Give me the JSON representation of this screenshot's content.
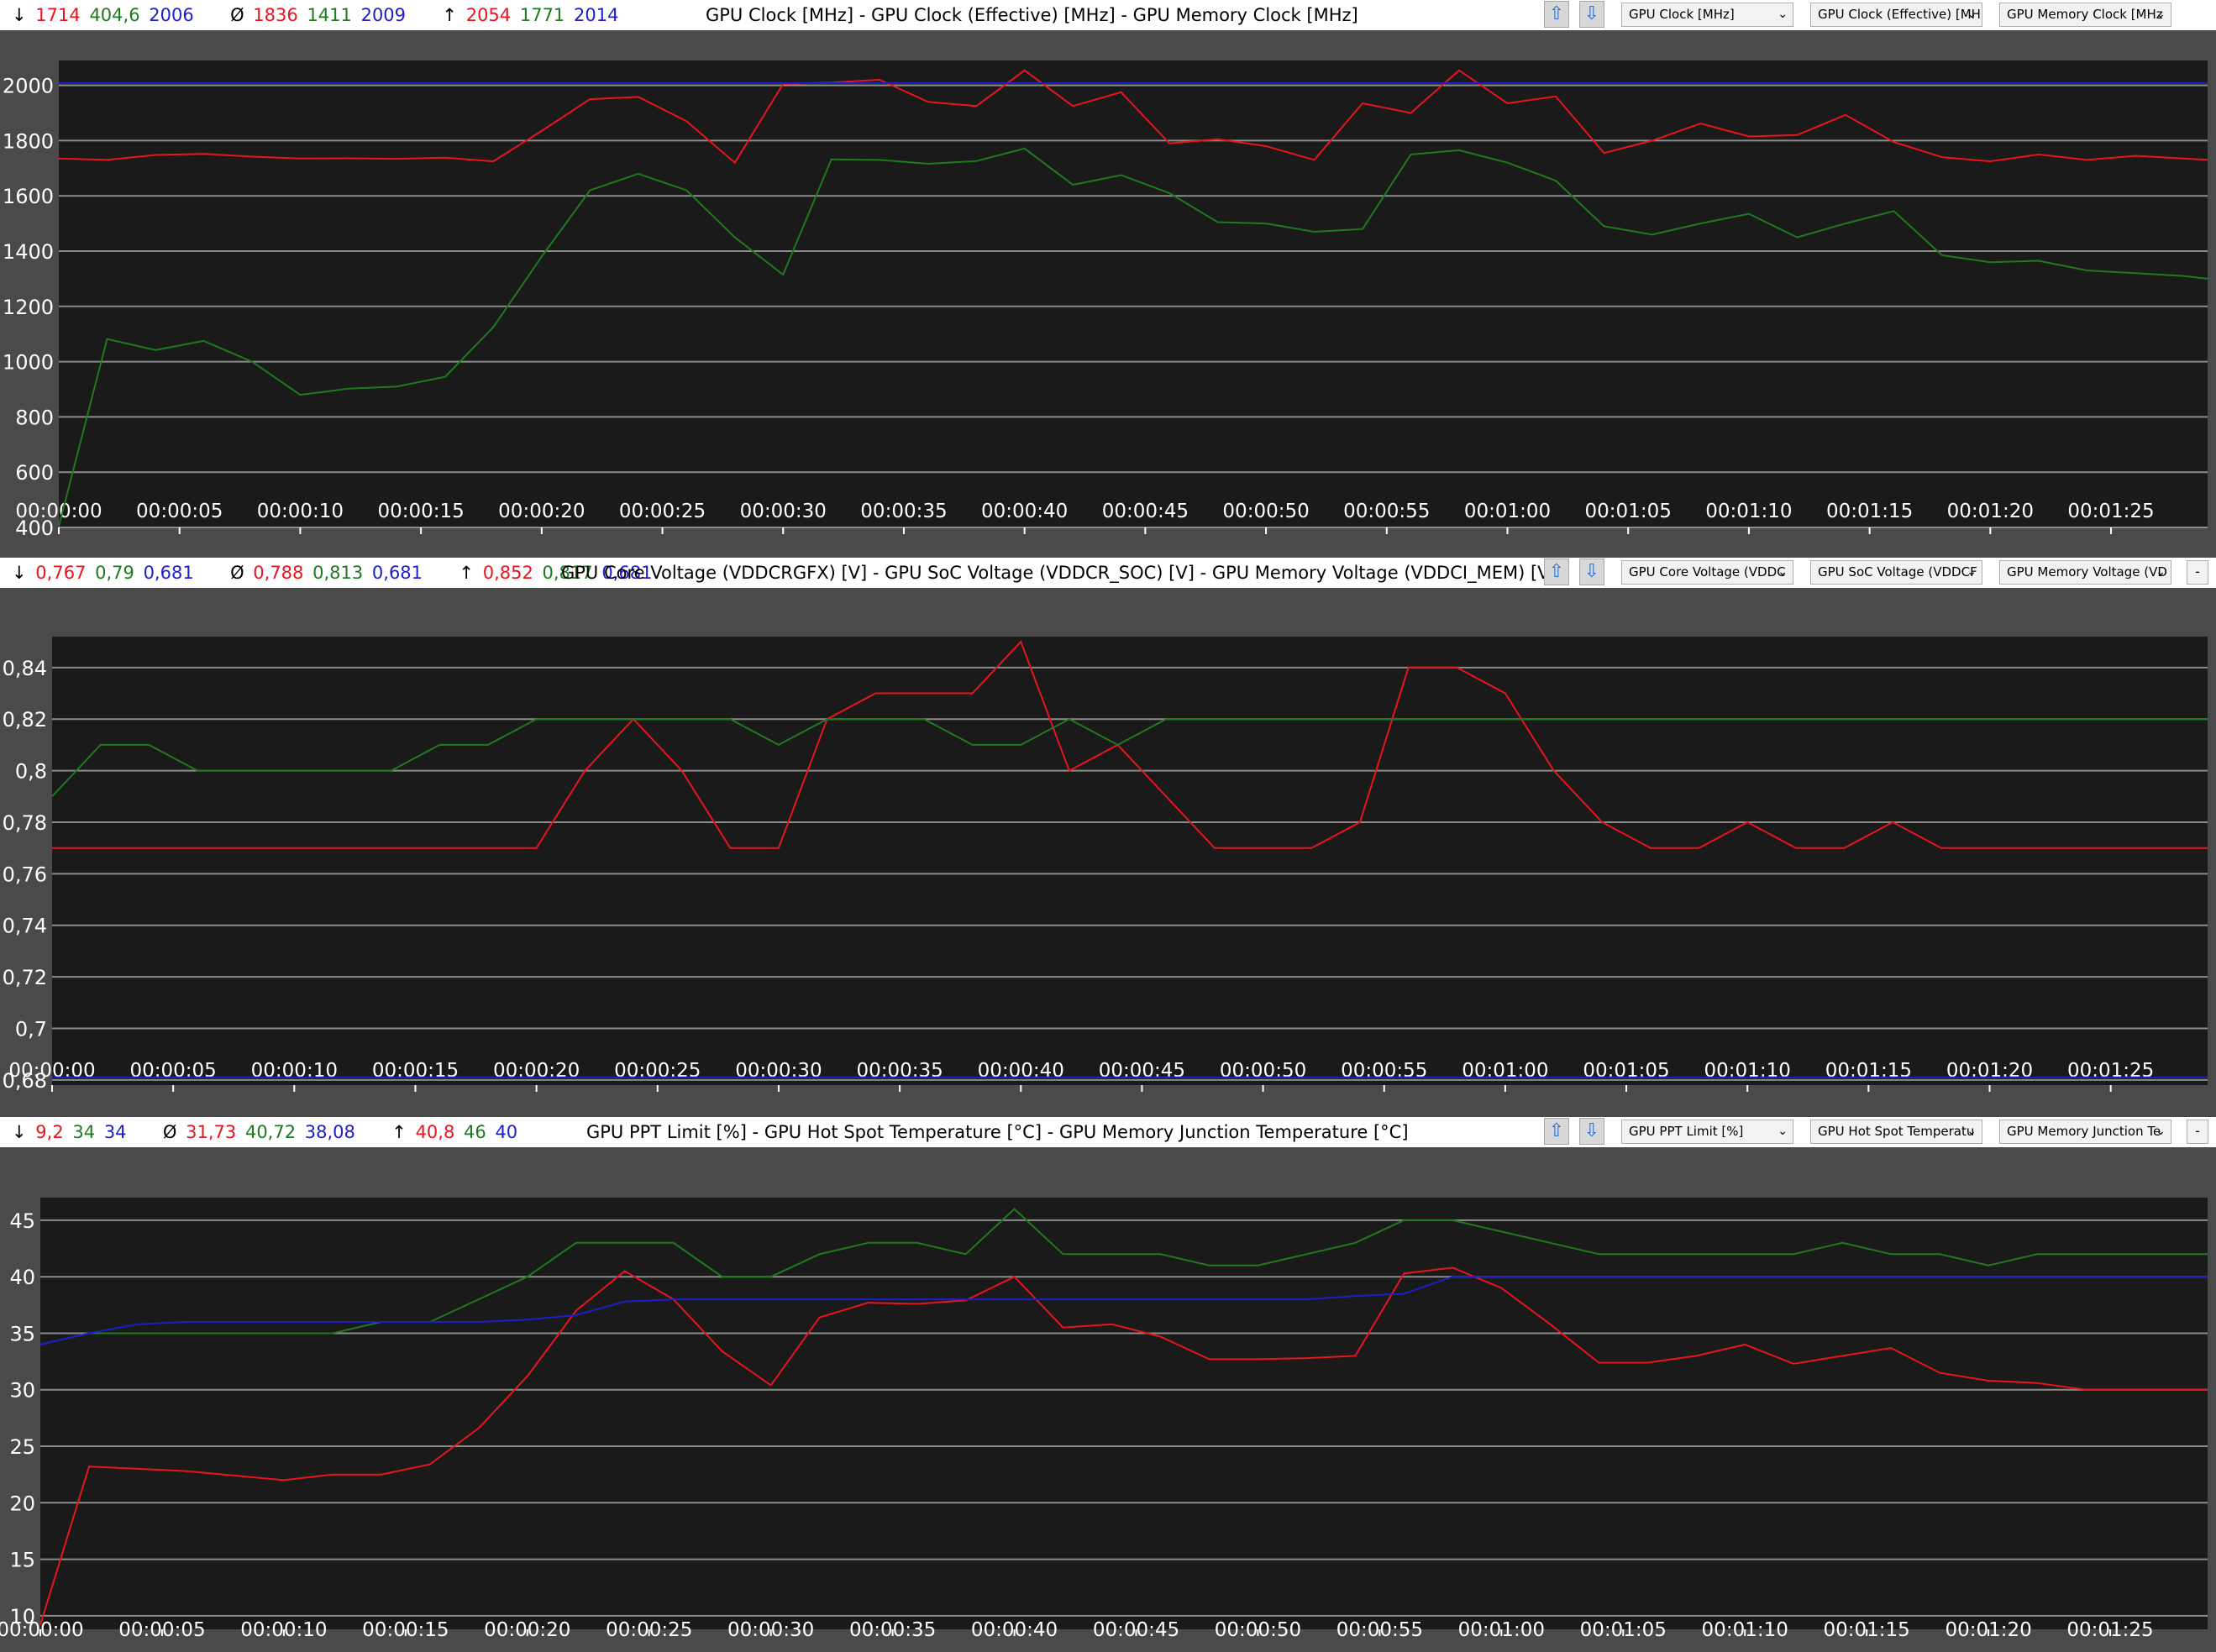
{
  "colors": {
    "red": "#e8141e",
    "green": "#1f7a1f",
    "blue": "#1e1ec8",
    "bg": "#4a4a4a",
    "plot": "#1a1a1a",
    "grid": "#8c8c8c",
    "tick": "#ffffff"
  },
  "icons": {
    "up": "arrow-up-icon",
    "down": "arrow-down-icon",
    "chevron": "chevron-down-icon"
  },
  "panels": [
    {
      "title": "GPU Clock [MHz]  -  GPU Clock (Effective) [MHz]  -  GPU Memory Clock [MHz]",
      "stats": {
        "min_symbol": "↓",
        "min": [
          "1714",
          "404,6",
          "2006"
        ],
        "avg_symbol": "Ø",
        "avg": [
          "1836",
          "1411",
          "2009"
        ],
        "max_symbol": "↑",
        "max": [
          "2054",
          "1771",
          "2014"
        ]
      },
      "dropdowns": [
        "GPU Clock [MHz]",
        "GPU Clock (Effective) [MH",
        "GPU Memory Clock [MHz"
      ],
      "has_minimize": false,
      "minimize_label": "-"
    },
    {
      "title": "GPU Core Voltage (VDDCRGFX) [V]  -  GPU SoC Voltage (VDDCR_SOC) [V]  -  GPU Memory Voltage (VDDCI_MEM) [V]",
      "stats": {
        "min_symbol": "↓",
        "min": [
          "0,767",
          "0,79",
          "0,681"
        ],
        "avg_symbol": "Ø",
        "avg": [
          "0,788",
          "0,813",
          "0,681"
        ],
        "max_symbol": "↑",
        "max": [
          "0,852",
          "0,817",
          "0,681"
        ]
      },
      "dropdowns": [
        "GPU Core Voltage (VDDC",
        "GPU SoC Voltage (VDDCF",
        "GPU Memory Voltage (VD"
      ],
      "has_minimize": true,
      "minimize_label": "-"
    },
    {
      "title": "GPU PPT Limit [%]  -  GPU Hot Spot Temperature [°C]  -  GPU Memory Junction Temperature [°C]",
      "stats": {
        "min_symbol": "↓",
        "min": [
          "9,2",
          "34",
          "34"
        ],
        "avg_symbol": "Ø",
        "avg": [
          "31,73",
          "40,72",
          "38,08"
        ],
        "max_symbol": "↑",
        "max": [
          "40,8",
          "46",
          "40"
        ]
      },
      "dropdowns": [
        "GPU PPT Limit [%]",
        "GPU Hot Spot Temperatu",
        "GPU Memory Junction Te"
      ],
      "has_minimize": true,
      "minimize_label": "-"
    }
  ],
  "chart_data": [
    {
      "type": "line",
      "title": "GPU Clock [MHz]  -  GPU Clock (Effective) [MHz]  -  GPU Memory Clock [MHz]",
      "x_unit": "seconds",
      "xlim": [
        0,
        89
      ],
      "ylim": [
        400,
        2090
      ],
      "yticks": [
        {
          "v": 400,
          "label": "400"
        },
        {
          "v": 600,
          "label": "600"
        },
        {
          "v": 800,
          "label": "800"
        },
        {
          "v": 1000,
          "label": "1000"
        },
        {
          "v": 1200,
          "label": "1200"
        },
        {
          "v": 1400,
          "label": "1400"
        },
        {
          "v": 1600,
          "label": "1600"
        },
        {
          "v": 1800,
          "label": "1800"
        },
        {
          "v": 2000,
          "label": "2000"
        }
      ],
      "xtick_labels": [
        "00:00:00",
        "00:00:05",
        "00:00:10",
        "00:00:15",
        "00:00:20",
        "00:00:25",
        "00:00:30",
        "00:00:35",
        "00:00:40",
        "00:00:45",
        "00:00:50",
        "00:00:55",
        "00:01:00",
        "00:01:05",
        "00:01:10",
        "00:01:15",
        "00:01:20",
        "00:01:25"
      ],
      "grid": true,
      "series": [
        {
          "name": "GPU Clock [MHz]",
          "color": "red",
          "x": [
            0,
            2,
            4,
            6,
            8,
            10,
            12,
            14,
            16,
            18,
            20,
            22,
            24,
            26,
            28,
            30,
            32,
            34,
            36,
            38,
            40,
            42,
            44,
            46,
            48,
            50,
            52,
            54,
            56,
            58,
            60,
            62,
            64,
            66,
            68,
            70,
            72,
            74,
            76,
            78,
            80,
            82,
            84,
            86,
            88,
            89
          ],
          "values": [
            1735,
            1730,
            1748,
            1752,
            1742,
            1735,
            1736,
            1734,
            1738,
            1725,
            1835,
            1950,
            1958,
            1870,
            1720,
            2005,
            2010,
            2020,
            1940,
            1925,
            2054,
            1925,
            1975,
            1790,
            1805,
            1780,
            1730,
            1935,
            1900,
            2054,
            1935,
            1960,
            1755,
            1800,
            1862,
            1815,
            1820,
            1893,
            1795,
            1740,
            1725,
            1750,
            1730,
            1745,
            1735,
            1730
          ]
        },
        {
          "name": "GPU Clock (Effective) [MHz]",
          "color": "green",
          "x": [
            0,
            2,
            4,
            6,
            8,
            10,
            12,
            14,
            16,
            18,
            20,
            22,
            24,
            26,
            28,
            30,
            32,
            34,
            36,
            38,
            40,
            42,
            44,
            46,
            48,
            50,
            52,
            54,
            56,
            58,
            60,
            62,
            64,
            66,
            68,
            70,
            72,
            74,
            76,
            78,
            80,
            82,
            84,
            86,
            88,
            89
          ],
          "values": [
            404.6,
            1082,
            1042,
            1075,
            1000,
            880,
            902,
            910,
            945,
            1125,
            1380,
            1620,
            1680,
            1620,
            1450,
            1315,
            1732,
            1730,
            1716,
            1726,
            1771,
            1640,
            1675,
            1610,
            1505,
            1500,
            1470,
            1480,
            1750,
            1765,
            1720,
            1655,
            1490,
            1460,
            1500,
            1535,
            1450,
            1500,
            1545,
            1385,
            1360,
            1365,
            1330,
            1320,
            1310,
            1300
          ]
        },
        {
          "name": "GPU Memory Clock [MHz]",
          "color": "blue",
          "x": [
            0,
            89
          ],
          "values": [
            2008,
            2008
          ]
        }
      ]
    },
    {
      "type": "line",
      "title": "GPU Core Voltage (VDDCRGFX) [V]  -  GPU SoC Voltage (VDDCR_SOC) [V]  -  GPU Memory Voltage (VDDCI_MEM) [V]",
      "x_unit": "seconds",
      "xlim": [
        0,
        89
      ],
      "ylim": [
        0.678,
        0.852
      ],
      "yticks": [
        {
          "v": 0.68,
          "label": "0,68"
        },
        {
          "v": 0.7,
          "label": "0,7"
        },
        {
          "v": 0.72,
          "label": "0,72"
        },
        {
          "v": 0.74,
          "label": "0,74"
        },
        {
          "v": 0.76,
          "label": "0,76"
        },
        {
          "v": 0.78,
          "label": "0,78"
        },
        {
          "v": 0.8,
          "label": "0,8"
        },
        {
          "v": 0.82,
          "label": "0,82"
        },
        {
          "v": 0.84,
          "label": "0,84"
        }
      ],
      "xtick_labels": [
        "00:00:00",
        "00:00:05",
        "00:00:10",
        "00:00:15",
        "00:00:20",
        "00:00:25",
        "00:00:30",
        "00:00:35",
        "00:00:40",
        "00:00:45",
        "00:00:50",
        "00:00:55",
        "00:01:00",
        "00:01:05",
        "00:01:10",
        "00:01:15",
        "00:01:20",
        "00:01:25"
      ],
      "grid": true,
      "series": [
        {
          "name": "GPU Core Voltage (VDDCRGFX) [V]",
          "color": "red",
          "x": [
            0,
            2,
            4,
            6,
            8,
            10,
            12,
            14,
            16,
            18,
            20,
            22,
            24,
            26,
            28,
            30,
            32,
            34,
            36,
            38,
            40,
            42,
            44,
            46,
            48,
            50,
            52,
            54,
            56,
            58,
            60,
            62,
            64,
            66,
            68,
            70,
            72,
            74,
            76,
            78,
            80,
            82,
            84,
            86,
            88,
            89
          ],
          "values": [
            0.77,
            0.77,
            0.77,
            0.77,
            0.77,
            0.77,
            0.77,
            0.77,
            0.77,
            0.77,
            0.77,
            0.8,
            0.82,
            0.8,
            0.77,
            0.77,
            0.82,
            0.83,
            0.83,
            0.83,
            0.85,
            0.8,
            0.81,
            0.79,
            0.77,
            0.77,
            0.77,
            0.78,
            0.84,
            0.84,
            0.83,
            0.8,
            0.78,
            0.77,
            0.77,
            0.78,
            0.77,
            0.77,
            0.78,
            0.77,
            0.77,
            0.77,
            0.77,
            0.77,
            0.77,
            0.77
          ]
        },
        {
          "name": "GPU SoC Voltage (VDDCR_SOC) [V]",
          "color": "green",
          "x": [
            0,
            2,
            4,
            6,
            8,
            10,
            12,
            14,
            16,
            18,
            20,
            22,
            24,
            26,
            28,
            30,
            32,
            34,
            36,
            38,
            40,
            42,
            44,
            46,
            48,
            50,
            52,
            54,
            56,
            58,
            60,
            62,
            64,
            66,
            68,
            70,
            72,
            74,
            76,
            78,
            80,
            82,
            84,
            86,
            88,
            89
          ],
          "values": [
            0.79,
            0.81,
            0.81,
            0.8,
            0.8,
            0.8,
            0.8,
            0.8,
            0.81,
            0.81,
            0.82,
            0.82,
            0.82,
            0.82,
            0.82,
            0.81,
            0.82,
            0.82,
            0.82,
            0.81,
            0.81,
            0.82,
            0.81,
            0.82,
            0.82,
            0.82,
            0.82,
            0.82,
            0.82,
            0.82,
            0.82,
            0.82,
            0.82,
            0.82,
            0.82,
            0.82,
            0.82,
            0.82,
            0.82,
            0.82,
            0.82,
            0.82,
            0.82,
            0.82,
            0.82,
            0.82
          ]
        },
        {
          "name": "GPU Memory Voltage (VDDCI_MEM) [V]",
          "color": "blue",
          "x": [
            0,
            89
          ],
          "values": [
            0.681,
            0.681
          ]
        }
      ]
    },
    {
      "type": "line",
      "title": "GPU PPT Limit [%]  -  GPU Hot Spot Temperature [°C]  -  GPU Memory Junction Temperature [°C]",
      "x_unit": "seconds",
      "xlim": [
        0,
        89
      ],
      "ylim": [
        8.8,
        47
      ],
      "yticks": [
        {
          "v": 10,
          "label": "10"
        },
        {
          "v": 15,
          "label": "15"
        },
        {
          "v": 20,
          "label": "20"
        },
        {
          "v": 25,
          "label": "25"
        },
        {
          "v": 30,
          "label": "30"
        },
        {
          "v": 35,
          "label": "35"
        },
        {
          "v": 40,
          "label": "40"
        },
        {
          "v": 45,
          "label": "45"
        }
      ],
      "xtick_labels": [
        "00:00:00",
        "00:00:05",
        "00:00:10",
        "00:00:15",
        "00:00:20",
        "00:00:25",
        "00:00:30",
        "00:00:35",
        "00:00:40",
        "00:00:45",
        "00:00:50",
        "00:00:55",
        "00:01:00",
        "00:01:05",
        "00:01:10",
        "00:01:15",
        "00:01:20",
        "00:01:25"
      ],
      "grid": true,
      "series": [
        {
          "name": "GPU PPT Limit [%]",
          "color": "red",
          "x": [
            0,
            2,
            4,
            6,
            8,
            10,
            12,
            14,
            16,
            18,
            20,
            22,
            24,
            26,
            28,
            30,
            32,
            34,
            36,
            38,
            40,
            42,
            44,
            46,
            48,
            50,
            52,
            54,
            56,
            58,
            60,
            62,
            64,
            66,
            68,
            70,
            72,
            74,
            76,
            78,
            80,
            82,
            84,
            86,
            88,
            89
          ],
          "values": [
            9.2,
            23.2,
            23.0,
            22.8,
            22.4,
            22.0,
            22.5,
            22.5,
            23.4,
            26.6,
            31.2,
            37.0,
            40.5,
            38.0,
            33.4,
            30.4,
            36.4,
            37.7,
            37.6,
            37.9,
            40.0,
            35.5,
            35.8,
            34.7,
            32.7,
            32.7,
            32.8,
            33.0,
            40.3,
            40.8,
            39.0,
            35.8,
            32.4,
            32.4,
            33.0,
            34.0,
            32.3,
            33.0,
            33.7,
            31.5,
            30.8,
            30.6,
            30.0,
            30.0,
            30.0,
            30.0
          ]
        },
        {
          "name": "GPU Hot Spot Temperature [°C]",
          "color": "green",
          "x": [
            0,
            2,
            4,
            6,
            8,
            10,
            12,
            14,
            16,
            18,
            20,
            22,
            24,
            26,
            28,
            30,
            32,
            34,
            36,
            38,
            40,
            42,
            44,
            46,
            48,
            50,
            52,
            54,
            56,
            58,
            60,
            62,
            64,
            66,
            68,
            70,
            72,
            74,
            76,
            78,
            80,
            82,
            84,
            86,
            88,
            89
          ],
          "values": [
            34,
            35,
            35,
            35,
            35,
            35,
            35,
            36,
            36,
            38,
            40,
            43,
            43,
            43,
            40,
            40,
            42,
            43,
            43,
            42,
            46,
            42,
            42,
            42,
            41,
            41,
            42,
            43,
            45,
            45,
            44,
            43,
            42,
            42,
            42,
            42,
            42,
            43,
            42,
            42,
            41,
            42,
            42,
            42,
            42,
            42
          ]
        },
        {
          "name": "GPU Memory Junction Temperature [°C]",
          "color": "blue",
          "x": [
            0,
            2,
            4,
            6,
            8,
            10,
            12,
            14,
            16,
            18,
            20,
            22,
            24,
            26,
            28,
            30,
            32,
            34,
            36,
            38,
            40,
            42,
            44,
            46,
            48,
            50,
            52,
            54,
            56,
            58,
            60,
            62,
            64,
            66,
            68,
            70,
            72,
            74,
            76,
            78,
            80,
            82,
            84,
            86,
            88,
            89
          ],
          "values": [
            34,
            35,
            35.8,
            36,
            36,
            36,
            36,
            36,
            36,
            36,
            36.2,
            36.6,
            37.8,
            38,
            38,
            38,
            38,
            38,
            38,
            38,
            38,
            38,
            38,
            38,
            38,
            38,
            38,
            38.3,
            38.5,
            40,
            40,
            40,
            40,
            40,
            40,
            40,
            40,
            40,
            40,
            40,
            40,
            40,
            40,
            40,
            40,
            40
          ]
        }
      ]
    }
  ]
}
